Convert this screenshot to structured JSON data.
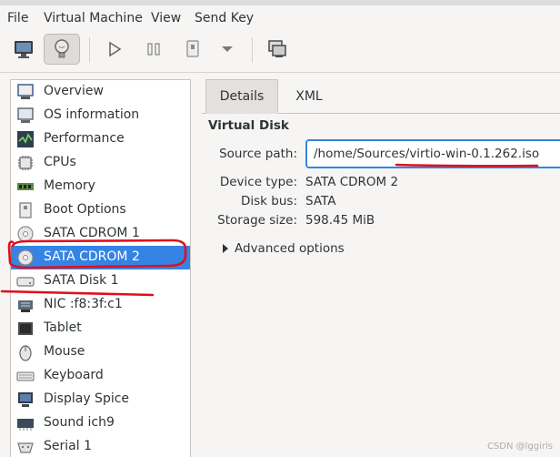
{
  "menu": [
    "File",
    "Virtual Machine",
    "View",
    "Send Key"
  ],
  "toolbar": {
    "buttons": [
      "monitor-icon",
      "lightbulb-icon",
      "play-icon",
      "pause-icon",
      "power-icon",
      "dropdown-icon",
      "screens-icon"
    ]
  },
  "sidebar": {
    "items": [
      {
        "label": "Overview",
        "icon": "overview-icon"
      },
      {
        "label": "OS information",
        "icon": "os-info-icon"
      },
      {
        "label": "Performance",
        "icon": "performance-icon"
      },
      {
        "label": "CPUs",
        "icon": "cpu-icon"
      },
      {
        "label": "Memory",
        "icon": "memory-icon"
      },
      {
        "label": "Boot Options",
        "icon": "boot-icon"
      },
      {
        "label": "SATA CDROM 1",
        "icon": "cdrom-icon"
      },
      {
        "label": "SATA CDROM 2",
        "icon": "cdrom-icon"
      },
      {
        "label": "SATA Disk 1",
        "icon": "disk-icon"
      },
      {
        "label": "NIC :f8:3f:c1",
        "icon": "nic-icon"
      },
      {
        "label": "Tablet",
        "icon": "tablet-icon"
      },
      {
        "label": "Mouse",
        "icon": "mouse-icon"
      },
      {
        "label": "Keyboard",
        "icon": "keyboard-icon"
      },
      {
        "label": "Display Spice",
        "icon": "display-icon"
      },
      {
        "label": "Sound ich9",
        "icon": "sound-icon"
      },
      {
        "label": "Serial 1",
        "icon": "serial-icon"
      }
    ],
    "selected_index": 7
  },
  "tabs": [
    "Details",
    "XML"
  ],
  "details": {
    "section_title": "Virtual Disk",
    "source_path_label": "Source path:",
    "source_path_value": "/home/Sources/virtio-win-0.1.262.iso",
    "device_type_label": "Device type:",
    "device_type_value": "SATA CDROM 2",
    "disk_bus_label": "Disk bus:",
    "disk_bus_value": "SATA",
    "storage_size_label": "Storage size:",
    "storage_size_value": "598.45 MiB",
    "advanced_label": "Advanced options"
  },
  "watermark": "CSDN @lggirls",
  "colors": {
    "accent": "#3584e4",
    "annotation": "#e0101a"
  }
}
